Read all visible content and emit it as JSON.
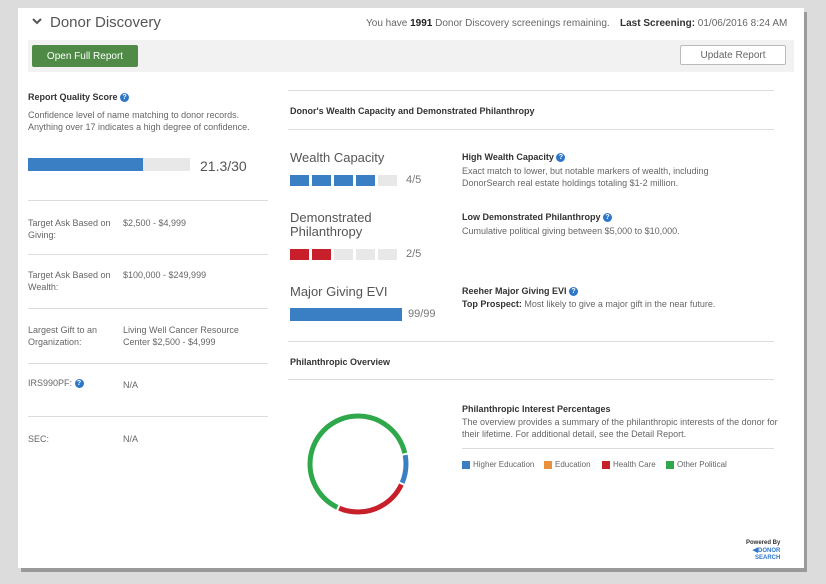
{
  "header": {
    "title": "Donor Discovery",
    "remaining_prefix": "You have ",
    "remaining_count": "1991",
    "remaining_suffix": " Donor Discovery screenings remaining.",
    "last_label": "Last Screening:",
    "last_value": " 01/06/2016 8:24 AM"
  },
  "toolbar": {
    "open_label": "Open Full Report",
    "update_label": "Update Report"
  },
  "quality": {
    "title": "Report Quality Score",
    "description": "Confidence level of name matching to donor records. Anything over 17 indicates a high degree of confidence.",
    "score": 21.3,
    "max": 30,
    "score_text": "21.3/30"
  },
  "fields": [
    {
      "label": "Target Ask Based on Giving:",
      "value": "$2,500 - $4,999"
    },
    {
      "label": "Target Ask Based on Wealth:",
      "value": "$100,000 - $249,999"
    },
    {
      "label": "Largest Gift to an Organization:",
      "value": "Living Well Cancer Resource Center $2,500 - $4,999"
    },
    {
      "label": "IRS990PF:",
      "value": "N/A"
    },
    {
      "label": "SEC:",
      "value": "N/A"
    }
  ],
  "wealth_section": {
    "title": "Donor's Wealth Capacity and Demonstrated Philanthropy",
    "wealth": {
      "label": "Wealth Capacity",
      "score": 4,
      "max": 5,
      "score_text": "4/5",
      "heading": "High Wealth Capacity",
      "description": "Exact match to lower, but notable markers of wealth, including DonorSearch real estate holdings totaling $1-2 million."
    },
    "philanthropy": {
      "label_line1": "Demonstrated",
      "label_line2": "Philanthropy",
      "score": 2,
      "max": 5,
      "score_text": "2/5",
      "heading": "Low Demonstrated Philanthropy",
      "description": "Cumulative political giving between $5,000 to $10,000."
    },
    "evi": {
      "label": "Major Giving EVI",
      "score": 99,
      "max": 99,
      "score_text": "99/99",
      "heading": "Reeher Major Giving EVI",
      "desc_bold": "Top Prospect:",
      "desc_rest": " Most likely to give a major gift in the near future."
    }
  },
  "overview": {
    "title": "Philanthropic Overview",
    "interest_title": "Philanthropic Interest Percentages",
    "interest_desc": "The overview provides a summary of the philanthropic interests of the donor for their lifetime. For additional detail, see the Detail Report."
  },
  "chart_data": {
    "type": "pie",
    "categories": [
      "Higher Education",
      "Education",
      "Health Care",
      "Other Political"
    ],
    "values": [
      10,
      0,
      25,
      65
    ],
    "colors": [
      "#3a7fc4",
      "#e8913a",
      "#c8202a",
      "#2ea84a"
    ]
  },
  "footer": {
    "powered_line1": "Powered By",
    "powered_line2": "DONOR",
    "powered_line3": "SEARCH"
  },
  "colors": {
    "accent_green": "#4f8a47",
    "bar_blue": "#3a7fc4",
    "bar_red": "#c8202a"
  }
}
